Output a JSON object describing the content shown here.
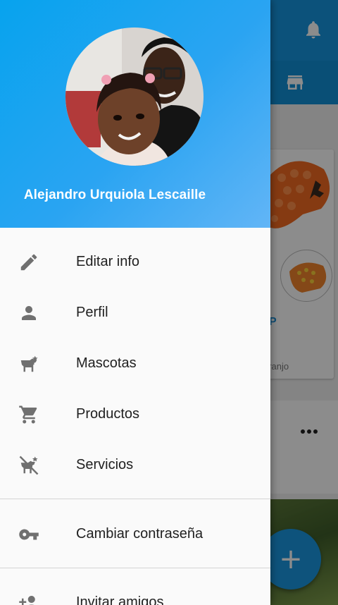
{
  "drawer": {
    "user_name": "Alejandro Urquiola Lescaille",
    "items": [
      {
        "label": "Editar info",
        "icon": "pencil-icon"
      },
      {
        "label": "Perfil",
        "icon": "person-icon"
      },
      {
        "label": "Mascotas",
        "icon": "dog-icon"
      },
      {
        "label": "Productos",
        "icon": "shopping-cart-icon"
      },
      {
        "label": "Servicios",
        "icon": "dog-service-icon"
      }
    ],
    "secondary_items": [
      {
        "label": "Cambiar contraseña",
        "icon": "key-icon"
      },
      {
        "label": "Invitar amigos",
        "icon": "add-person-icon"
      }
    ]
  },
  "background": {
    "card_price_partial": "P",
    "card_subtitle_partial": "aranjo"
  },
  "colors": {
    "header_start": "#07a3ee",
    "header_end": "#62b5f6",
    "app_bar": "#1796e0",
    "fab": "#1b97e2",
    "icon_gray": "#707070"
  }
}
